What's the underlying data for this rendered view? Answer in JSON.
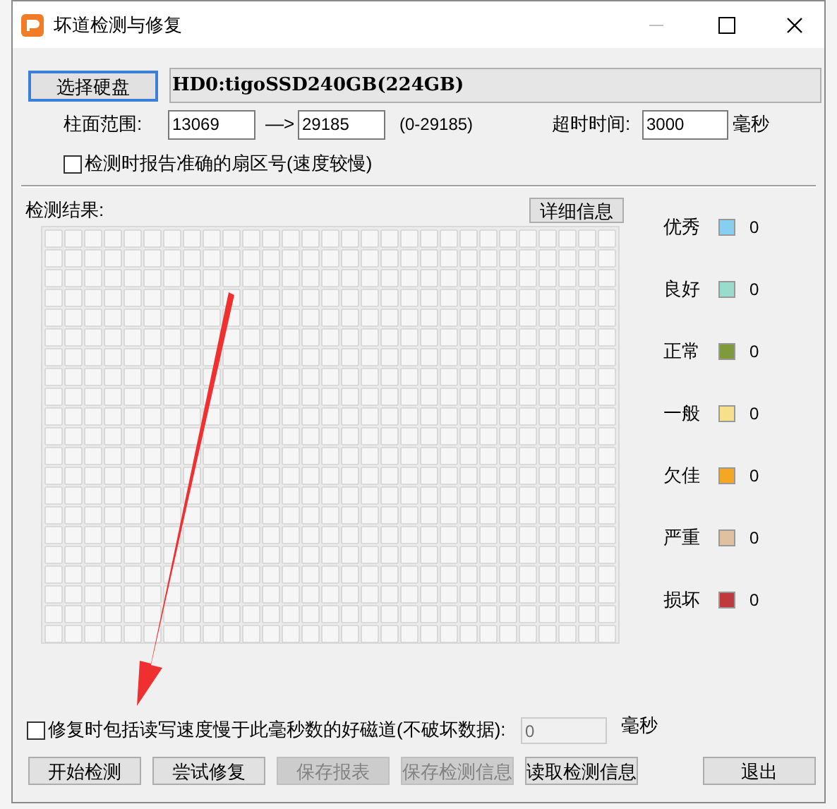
{
  "window": {
    "title": "坏道检测与修复"
  },
  "drive": {
    "button": "选择硬盘",
    "value": "HD0:tigoSSD240GB(224GB)"
  },
  "range": {
    "label": "柱面范围:",
    "from": "13069",
    "arrow": "—>",
    "to": "29185",
    "hint": "(0-29185)"
  },
  "timeout": {
    "label": "超时时间:",
    "value": "3000",
    "unit": "毫秒"
  },
  "exact_sector": {
    "label": "检测时报告准确的扇区号(速度较慢)",
    "checked": false
  },
  "results": {
    "label": "检测结果:",
    "details_button": "详细信息"
  },
  "legend": [
    {
      "label": "优秀",
      "color": "#87cef0",
      "count": "0"
    },
    {
      "label": "良好",
      "color": "#99dccb",
      "count": "0"
    },
    {
      "label": "正常",
      "color": "#7f9a3a",
      "count": "0"
    },
    {
      "label": "一般",
      "color": "#f7e08c",
      "count": "0"
    },
    {
      "label": "欠佳",
      "color": "#f5a623",
      "count": "0"
    },
    {
      "label": "严重",
      "color": "#e0c0a0",
      "count": "0"
    },
    {
      "label": "损坏",
      "color": "#c0393f",
      "count": "0"
    }
  ],
  "repair_slow": {
    "label": "修复时包括读写速度慢于此毫秒数的好磁道(不破坏数据):",
    "checked": false,
    "value": "0",
    "disabled": true,
    "unit": "毫秒"
  },
  "buttons": [
    {
      "label": "开始检测",
      "disabled": false
    },
    {
      "label": "尝试修复",
      "disabled": false
    },
    {
      "label": "保存报表",
      "disabled": true
    },
    {
      "label": "保存检测信息",
      "disabled": true
    },
    {
      "label": "读取检测信息",
      "disabled": false
    },
    {
      "label": "退出",
      "disabled": false
    }
  ]
}
